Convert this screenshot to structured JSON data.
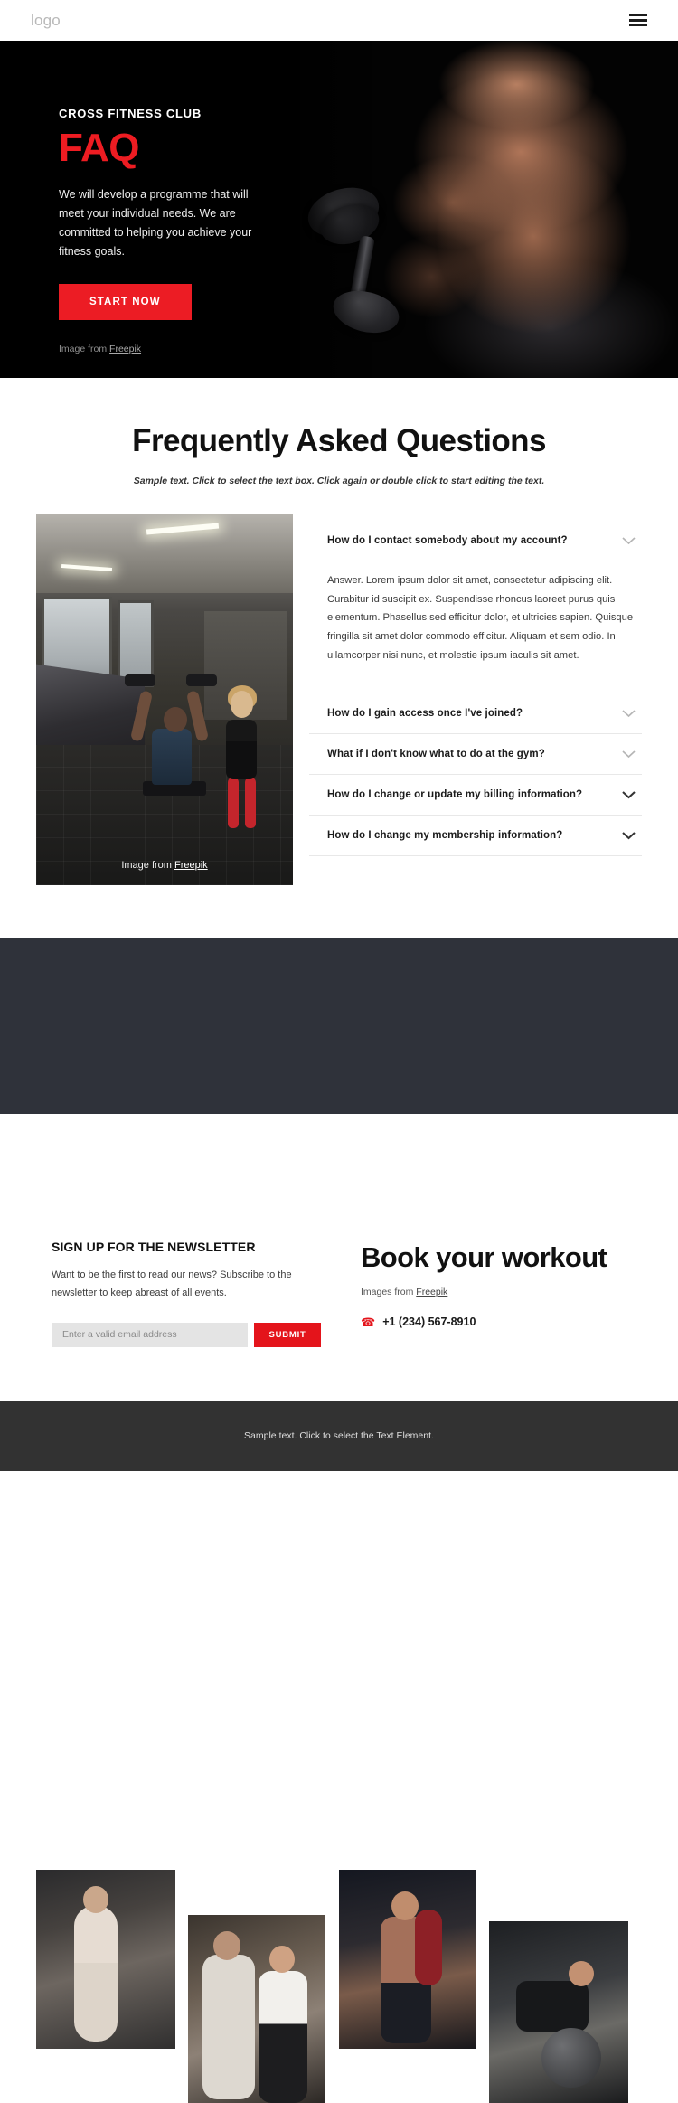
{
  "header": {
    "logo": "logo",
    "menu_icon": "hamburger-icon"
  },
  "hero": {
    "eyebrow": "CROSS FITNESS CLUB",
    "title": "FAQ",
    "description": "We will develop a programme that will meet your individual needs. We are committed to helping you achieve your fitness goals.",
    "cta_label": "START NOW",
    "credit_prefix": "Image from ",
    "credit_link": "Freepik",
    "accent_color": "#ec1c24",
    "background_color": "#000000"
  },
  "faq": {
    "title": "Frequently Asked Questions",
    "subtitle": "Sample text. Click to select the text box. Click again or double click to start editing the text.",
    "image_credit_prefix": "Image from ",
    "image_credit_link": "Freepik",
    "items": [
      {
        "question": "How do I contact somebody about my account?",
        "expanded": true,
        "answer": "Answer. Lorem ipsum dolor sit amet, consectetur adipiscing elit. Curabitur id suscipit ex. Suspendisse rhoncus laoreet purus quis elementum. Phasellus sed efficitur dolor, et ultricies sapien. Quisque fringilla sit amet dolor commodo efficitur. Aliquam et sem odio. In ullamcorper nisi nunc, et molestie ipsum iaculis sit amet."
      },
      {
        "question": "How do I gain access once I've joined?",
        "expanded": false,
        "answer": ""
      },
      {
        "question": "What if I don't know what to do at the gym?",
        "expanded": false,
        "answer": ""
      },
      {
        "question": "How do I change or update my billing information?",
        "expanded": false,
        "answer": ""
      },
      {
        "question": "How do I change my membership information?",
        "expanded": false,
        "answer": ""
      }
    ]
  },
  "gallery": {
    "band_color": "#2f323a",
    "images": [
      {
        "alt": "woman-at-cable-machine"
      },
      {
        "alt": "trainer-assisting-woman-with-dumbbell"
      },
      {
        "alt": "man-with-battle-rope"
      },
      {
        "alt": "man-doing-stability-ball-pushup"
      }
    ]
  },
  "newsletter": {
    "title": "SIGN UP FOR THE NEWSLETTER",
    "description": "Want to be the first to read our news? Subscribe to the newsletter to keep abreast of all events.",
    "email_placeholder": "Enter a valid email address",
    "email_value": "",
    "submit_label": "SUBMIT",
    "submit_color": "#e4141b"
  },
  "contact": {
    "title": "Book your workout",
    "credit_prefix": "Images from ",
    "credit_link": "Freepik",
    "phone": "+1 (234) 567-8910",
    "phone_icon": "phone-icon",
    "phone_color": "#e4141b"
  },
  "footer": {
    "text": "Sample text. Click to select the Text Element.",
    "background_color": "#323232"
  }
}
